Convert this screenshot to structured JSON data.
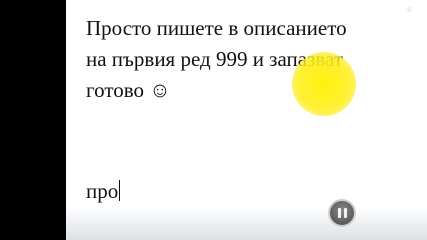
{
  "slide": {
    "lines": [
      "Просто пишете в описанието",
      "на първия ред 999 и запазват",
      "готово ☺"
    ],
    "typed_text": "про"
  },
  "watermark": "ᴴᴰ",
  "controls": {
    "pause_icon": "pause-icon"
  },
  "colors": {
    "highlight": "#FFF000",
    "page_background": "#FFFFFF",
    "letterbox": "#000000"
  }
}
